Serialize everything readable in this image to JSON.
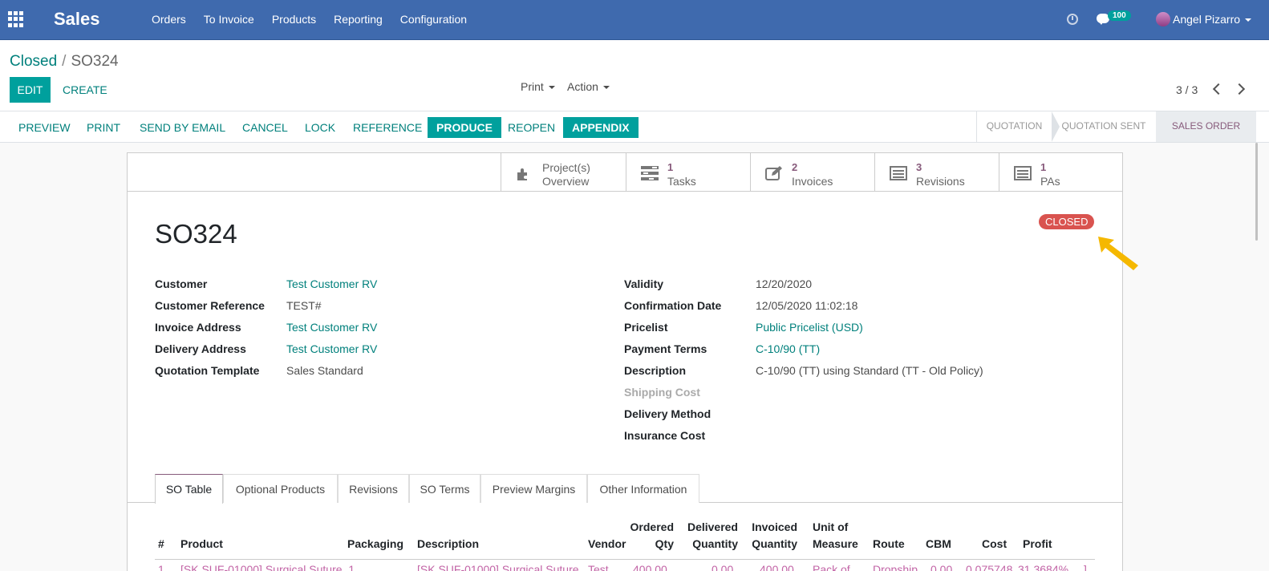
{
  "navbar": {
    "app_name": "Sales",
    "menu": [
      "Orders",
      "To Invoice",
      "Products",
      "Reporting",
      "Configuration"
    ],
    "messages_count": "100",
    "user_name": "Angel Pizarro",
    "icons": [
      "apps-grid-icon",
      "clock-icon",
      "chat-icon",
      "avatar"
    ]
  },
  "control_panel": {
    "breadcrumb_parent": "Closed",
    "breadcrumb_current": "SO324",
    "edit_label": "EDIT",
    "create_label": "CREATE",
    "print_label": "Print",
    "action_label": "Action",
    "pager": "3 / 3"
  },
  "header": {
    "buttons": [
      "PREVIEW",
      "PRINT",
      "SEND BY EMAIL",
      "CANCEL",
      "LOCK",
      "REFERENCE",
      "PRODUCE",
      "REOPEN",
      "APPENDIX"
    ],
    "primary_buttons": [
      "PRODUCE",
      "APPENDIX"
    ],
    "statusbar": [
      "QUOTATION",
      "QUOTATION SENT",
      "SALES ORDER"
    ],
    "active_status": "SALES ORDER"
  },
  "smart_buttons": [
    {
      "value": "",
      "label_line1": "Project(s)",
      "label": "Overview",
      "icon": "puzzle-icon"
    },
    {
      "value": "1",
      "label": "Tasks",
      "icon": "tasks-icon"
    },
    {
      "value": "2",
      "label": "Invoices",
      "icon": "pencil-square-icon"
    },
    {
      "value": "3",
      "label": "Revisions",
      "icon": "list-alt-icon"
    },
    {
      "value": "1",
      "label": "PAs",
      "icon": "list-alt-icon"
    }
  ],
  "order": {
    "name": "SO324",
    "state_badge": "CLOSED",
    "left_fields": [
      {
        "label": "Customer",
        "value": "Test Customer RV",
        "link": true
      },
      {
        "label": "Customer Reference",
        "value": "TEST#",
        "link": false
      },
      {
        "label": "Invoice Address",
        "value": "Test Customer RV",
        "link": true
      },
      {
        "label": "Delivery Address",
        "value": "Test Customer RV",
        "link": true
      },
      {
        "label": "Quotation Template",
        "value": "Sales Standard",
        "link": false
      }
    ],
    "right_fields": [
      {
        "label": "Validity",
        "value": "12/20/2020",
        "link": false
      },
      {
        "label": "Confirmation Date",
        "value": "12/05/2020 11:02:18",
        "link": false
      },
      {
        "label": "Pricelist",
        "value": "Public Pricelist (USD)",
        "link": true
      },
      {
        "label": "Payment Terms",
        "value": "C-10/90 (TT)",
        "link": true
      },
      {
        "label": "Description",
        "value": "C-10/90 (TT) using Standard (TT - Old Policy)",
        "link": false
      },
      {
        "label": "Shipping Cost",
        "value": "",
        "link": false,
        "muted": true
      },
      {
        "label": "Delivery Method",
        "value": "",
        "link": false
      },
      {
        "label": "Insurance Cost",
        "value": "",
        "link": false
      }
    ]
  },
  "tabs": [
    "SO Table",
    "Optional Products",
    "Revisions",
    "SO Terms",
    "Preview Margins",
    "Other Information"
  ],
  "active_tab": "SO Table",
  "table": {
    "headers": [
      {
        "l1": "",
        "l2": "#"
      },
      {
        "l1": "",
        "l2": "Product"
      },
      {
        "l1": "",
        "l2": "Packaging"
      },
      {
        "l1": "",
        "l2": "Description"
      },
      {
        "l1": "",
        "l2": "Vendor"
      },
      {
        "l1": "Ordered",
        "l2": "Qty"
      },
      {
        "l1": "Delivered",
        "l2": "Quantity"
      },
      {
        "l1": "Invoiced",
        "l2": "Quantity"
      },
      {
        "l1": "Unit of",
        "l2": "Measure"
      },
      {
        "l1": "",
        "l2": "Route"
      },
      {
        "l1": "",
        "l2": "CBM"
      },
      {
        "l1": "",
        "l2": "Cost"
      },
      {
        "l1": "",
        "l2": "Profit"
      }
    ],
    "first_row": [
      "1",
      "[SK SUF-01000] Surgical Suture, 1",
      "",
      "[SK SUF-01000] Surgical Suture",
      "Test",
      "400.00",
      "0.00",
      "400.00",
      "Pack of",
      "Dropship",
      "0.00",
      "0.075748",
      "31.3684%",
      "]"
    ]
  },
  "colors": {
    "navbar": "#3f6aae",
    "primary": "#00a09d",
    "link": "#00807c",
    "accent": "#875a7b",
    "danger": "#d9534f",
    "arrow": "#f5b800"
  }
}
